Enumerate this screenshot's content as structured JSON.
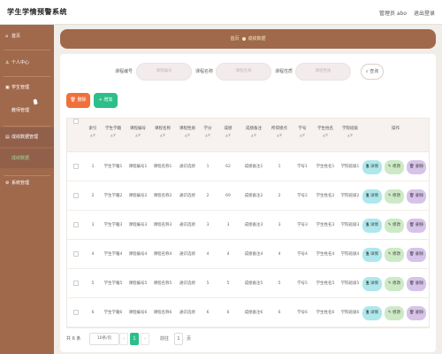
{
  "header": {
    "app_title": "学生学情预警系统",
    "user_label": "管理员 abo",
    "logout_label": "退出登录"
  },
  "sidebar": {
    "items": [
      {
        "label": "首页",
        "icon": "home-icon"
      },
      {
        "label": "个人中心",
        "icon": "user-icon"
      },
      {
        "label": "学生管理",
        "icon": "student-icon"
      },
      {
        "label": "教师管理",
        "icon": "teacher-icon"
      },
      {
        "label": "成绩数据管理",
        "icon": "data-icon"
      },
      {
        "label": "成绩数据",
        "icon": ""
      },
      {
        "label": "系统管理",
        "icon": "settings-icon"
      }
    ]
  },
  "breadcrumb": {
    "home": "首页",
    "current": "成绩数据"
  },
  "search": {
    "fields": [
      {
        "label": "课程编号",
        "placeholder": "课程编号"
      },
      {
        "label": "课程名称",
        "placeholder": "课程名称"
      },
      {
        "label": "课程性质",
        "placeholder": "课程性质"
      }
    ],
    "button_label": "查询"
  },
  "actions": {
    "delete_label": "删除",
    "add_label": "增加"
  },
  "table": {
    "columns": [
      "索引",
      "学生学籍",
      "课程编号",
      "课程名称",
      "课程性质",
      "学分",
      "成绩",
      "成绩备注",
      "所得绩点",
      "学号",
      "学生姓名",
      "学院班级",
      "操作"
    ],
    "rows": [
      [
        "1",
        "学生学籍1",
        "课程编号1",
        "课程名称1",
        "通识选修",
        "1",
        "62",
        "成绩备注1",
        "1",
        "学号1",
        "学生姓名1",
        "学院班级1"
      ],
      [
        "2",
        "学生学籍2",
        "课程编号2",
        "课程名称2",
        "通识选修",
        "2",
        "69",
        "成绩备注2",
        "2",
        "学号2",
        "学生姓名2",
        "学院班级2"
      ],
      [
        "3",
        "学生学籍3",
        "课程编号3",
        "课程名称3",
        "通识选修",
        "3",
        "3",
        "成绩备注3",
        "3",
        "学号3",
        "学生姓名3",
        "学院班级3"
      ],
      [
        "4",
        "学生学籍4",
        "课程编号4",
        "课程名称4",
        "通识选修",
        "4",
        "4",
        "成绩备注4",
        "4",
        "学号4",
        "学生姓名4",
        "学院班级4"
      ],
      [
        "5",
        "学生学籍5",
        "课程编号5",
        "课程名称5",
        "通识选修",
        "5",
        "5",
        "成绩备注5",
        "5",
        "学号5",
        "学生姓名5",
        "学院班级5"
      ],
      [
        "6",
        "学生学籍6",
        "课程编号6",
        "课程名称6",
        "通识选修",
        "6",
        "6",
        "成绩备注6",
        "6",
        "学号6",
        "学生姓名6",
        "学院班级6"
      ]
    ],
    "row_actions": {
      "view": "详情",
      "edit": "修改",
      "delete": "删除"
    }
  },
  "pager": {
    "total": "共 6 条",
    "page_size": "10条/页",
    "prev": "‹",
    "current_page": "1",
    "next": "›",
    "goto_label": "前往",
    "goto_value": "1",
    "page_suffix": "页"
  },
  "colors": {
    "accent": "#a0694b",
    "add_button": "#2dbf8a",
    "delete_button": "#f0703b"
  }
}
